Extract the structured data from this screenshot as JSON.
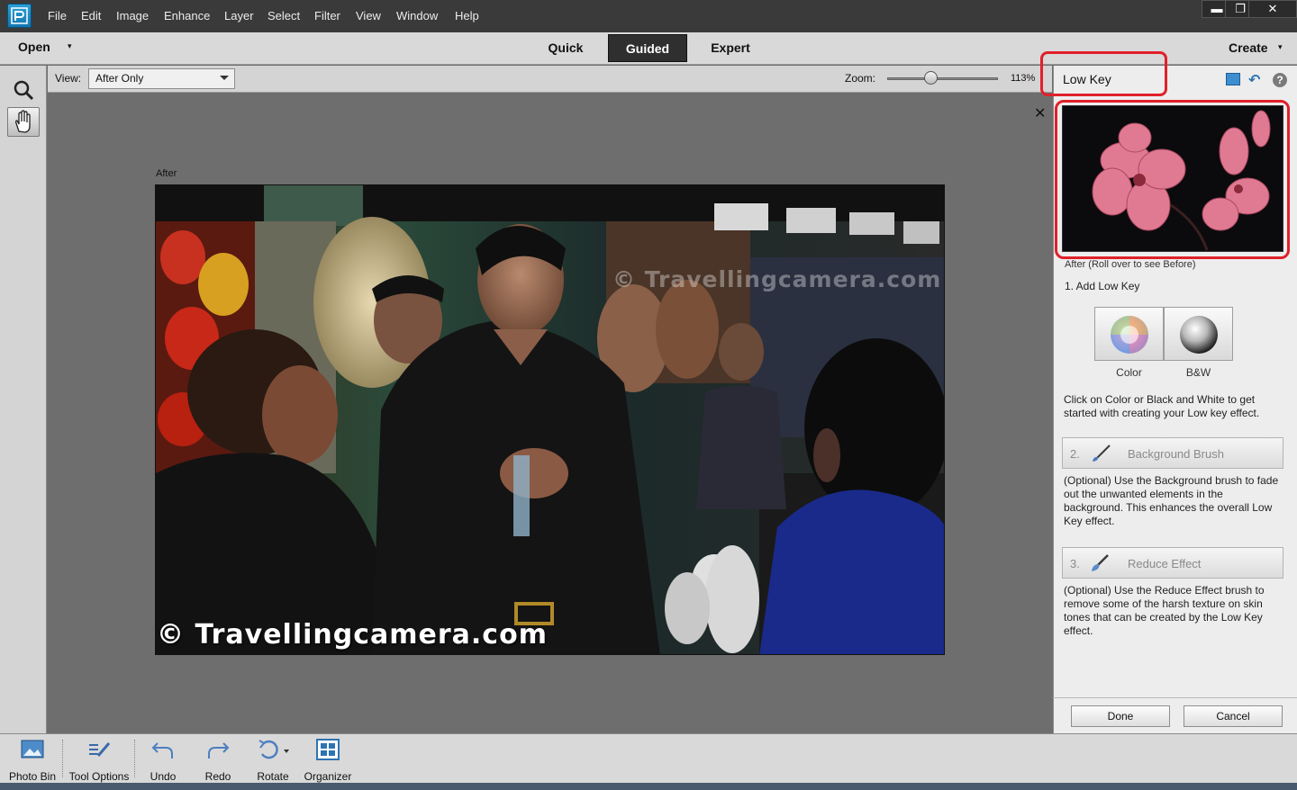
{
  "menubar": {
    "items": [
      "File",
      "Edit",
      "Image",
      "Enhance",
      "Layer",
      "Select",
      "Filter",
      "View",
      "Window",
      "Help"
    ],
    "window_controls": [
      "minimize-icon",
      "restore-icon",
      "close-icon"
    ],
    "minimize_glyph": "▬",
    "restore_glyph": "❐",
    "close_glyph": "✕"
  },
  "modebar": {
    "open_label": "Open",
    "tabs": [
      "Quick",
      "Guided",
      "Expert"
    ],
    "active_tab": "Guided",
    "create_label": "Create",
    "dropdown_glyph": "▾"
  },
  "options": {
    "view_label": "View:",
    "view_value": "After Only",
    "zoom_label": "Zoom:",
    "zoom_value": "113%",
    "zoom_fraction": 0.4
  },
  "tools": [
    "zoom-tool-icon",
    "hand-tool-icon"
  ],
  "canvas": {
    "close_glyph": "✕",
    "after_label": "After",
    "watermark_top": "© Travellingcamera.com",
    "watermark_bottom": "© Travellingcamera.com"
  },
  "panel": {
    "title": "Low Key",
    "thumb_caption": "After (Roll over to see Before)",
    "step1_title": "1. Add Low Key",
    "effects": [
      {
        "label": "Color",
        "icon": "color-orb-icon"
      },
      {
        "label": "B&W",
        "icon": "bw-orb-icon"
      }
    ],
    "step1_desc": "Click on Color or Black and White to get started with creating your Low key effect.",
    "step2": {
      "num": "2.",
      "label": "Background Brush",
      "icon": "brush-icon"
    },
    "step2_desc": "(Optional) Use the Background brush to fade out the unwanted elements in the background. This enhances the overall Low Key effect.",
    "step3": {
      "num": "3.",
      "label": "Reduce Effect",
      "icon": "eraser-brush-icon"
    },
    "step3_desc": "(Optional) Use the Reduce Effect brush to remove some of the harsh texture on skin tones that can be created by the Low Key effect.",
    "done_label": "Done",
    "cancel_label": "Cancel",
    "help_glyph": "?",
    "reset_glyph": "↶"
  },
  "bottombar": {
    "items": [
      {
        "label": "Photo Bin",
        "icon": "photo-bin-icon"
      },
      {
        "label": "Tool Options",
        "icon": "tool-options-icon"
      },
      {
        "label": "Undo",
        "icon": "undo-icon"
      },
      {
        "label": "Redo",
        "icon": "redo-icon"
      },
      {
        "label": "Rotate",
        "icon": "rotate-icon"
      },
      {
        "label": "Organizer",
        "icon": "organizer-icon"
      }
    ]
  },
  "colors": {
    "highlight_red": "#e0202a",
    "accent_blue": "#2d74b3",
    "menubar": "#3a3a3a",
    "canvas": "#6e6e6e"
  }
}
